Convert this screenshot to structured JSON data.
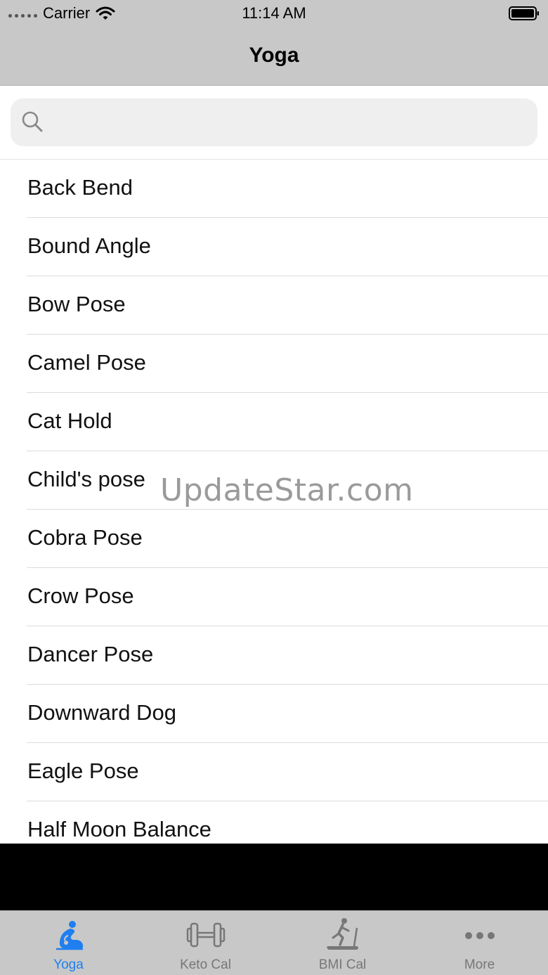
{
  "status": {
    "carrier": "Carrier",
    "time": "11:14 AM"
  },
  "nav": {
    "title": "Yoga"
  },
  "search": {
    "placeholder": ""
  },
  "list": {
    "items": [
      {
        "label": "Back Bend"
      },
      {
        "label": "Bound Angle"
      },
      {
        "label": "Bow Pose"
      },
      {
        "label": "Camel Pose"
      },
      {
        "label": "Cat Hold"
      },
      {
        "label": "Child's pose"
      },
      {
        "label": "Cobra Pose"
      },
      {
        "label": "Crow Pose"
      },
      {
        "label": "Dancer Pose"
      },
      {
        "label": "Downward Dog"
      },
      {
        "label": "Eagle Pose"
      },
      {
        "label": "Half Moon Balance"
      }
    ]
  },
  "watermark": "UpdateStar.com",
  "tabs": [
    {
      "label": "Yoga",
      "icon": "yoga-icon",
      "active": true
    },
    {
      "label": "Keto Cal",
      "icon": "dumbbell-icon",
      "active": false
    },
    {
      "label": "BMI Cal",
      "icon": "treadmill-icon",
      "active": false
    },
    {
      "label": "More",
      "icon": "more-dots-icon",
      "active": false
    }
  ],
  "colors": {
    "accent": "#1f7ff0",
    "bar": "#c8c8c8",
    "inactive": "#777777"
  }
}
